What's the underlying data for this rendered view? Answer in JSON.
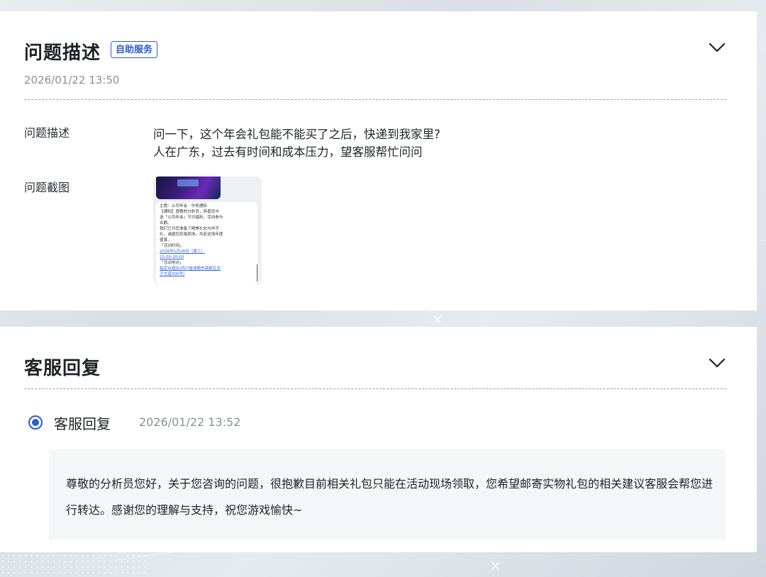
{
  "issue_section": {
    "title": "问题描述",
    "badge": "自助服务",
    "timestamp": "2026/01/22 13:50",
    "collapse_icon": "chevron-down-icon",
    "desc_label": "问题描述",
    "desc_lines": [
      "问一下，这个年会礼包能不能买了之后，快递到我家里?",
      "人在广东，过去有时间和成本压力，望客服帮忙问问"
    ],
    "screenshot_label": "问题截图",
    "screenshot_lines": [
      "主题：公司年会 · 中奖通知",
      "【通知】尊敬的分析员，恭喜您中",
      "选「公司年会」节日福利，活动参与",
      "名额。",
      "我们已为您准备了精美礼包与伴手",
      "礼，诚邀您莅临现场，共赴这场年度",
      "盛宴。",
      "「活动时间」",
      "2026年1月28日（周三）",
      "15:00-20:00",
      "「活动地点」",
      "指定W酒店(四川省成都市高新区交",
      "子大道300号)"
    ]
  },
  "reply_section": {
    "title": "客服回复",
    "collapse_icon": "chevron-down-icon",
    "reply_author": "客服回复",
    "reply_time": "2026/01/22 13:52",
    "reply_text": "尊敬的分析员您好，关于您咨询的问题，很抱歉目前相关礼包只能在活动现场领取，您希望邮寄实物礼包的相关建议客服会帮您进行转达。感谢您的理解与支持，祝您游戏愉快~"
  },
  "colors": {
    "accent": "#2d5bd7",
    "muted_text": "#8a9099",
    "reply_bg": "#f5f6f8"
  }
}
